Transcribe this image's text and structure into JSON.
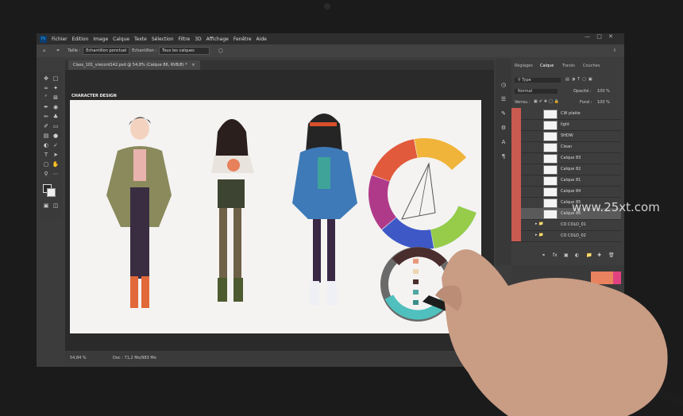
{
  "menu": {
    "logo": "Ps",
    "items": [
      "Fichier",
      "Edition",
      "Image",
      "Calque",
      "Texte",
      "Sélection",
      "Filtre",
      "3D",
      "Affichage",
      "Fenêtre",
      "Aide"
    ]
  },
  "options_bar": {
    "taille_label": "Taille :",
    "taille_value": "Echantillon ponctuel",
    "echantillon_label": "Echantillon :",
    "echantillon_value": "Tous les calques"
  },
  "document": {
    "tab_title": "Class_101_vrecord142.psd @ 54,8% (Calque 86, RVB/8) *",
    "artboard_label": "CHARACTER DESIGN"
  },
  "status": {
    "zoom": "54,84 %",
    "doc": "Doc : 71,2 Mo/983 Mo"
  },
  "panel": {
    "tabs": [
      "Réglages",
      "Calque",
      "Tracés",
      "Couches"
    ],
    "active_tab": "Calque",
    "filter_label": "Type",
    "blend_mode": "Normal",
    "opacity_label": "Opacité :",
    "opacity_value": "100 %",
    "lock_label": "Verrou :",
    "fill_label": "Fond :",
    "fill_value": "100 %",
    "layers": [
      "CW platte",
      "light",
      "SHDW",
      "Clean",
      "Calque 83",
      "Calque 82",
      "Calque 81",
      "Calque 84",
      "Calque 85",
      "Calque 86",
      "CO COLO_01",
      "CO COLO_02"
    ],
    "selected_layer": "Calque 86"
  },
  "watermark": "www.25xt.com",
  "colors": {
    "accent": "#31a8ff",
    "layer_eye": "#c95a50"
  }
}
